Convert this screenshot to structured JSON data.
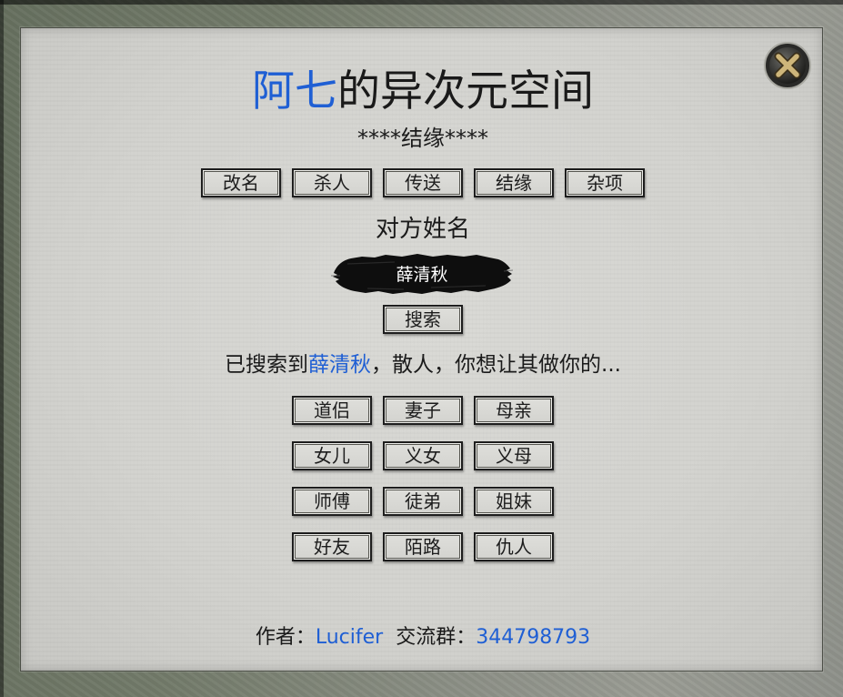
{
  "window": {
    "title_highlight": "阿七",
    "title_rest": "的异次元空间",
    "subtitle": "****结缘****"
  },
  "tabs": [
    {
      "label": "改名"
    },
    {
      "label": "杀人"
    },
    {
      "label": "传送"
    },
    {
      "label": "结缘"
    },
    {
      "label": "杂项"
    }
  ],
  "search": {
    "field_label": "对方姓名",
    "value": "薛清秋",
    "button_label": "搜索"
  },
  "result": {
    "prefix": "已搜索到",
    "name": "薛清秋",
    "suffix": "，散人，你想让其做你的..."
  },
  "relations": [
    {
      "label": "道侣"
    },
    {
      "label": "妻子"
    },
    {
      "label": "母亲"
    },
    {
      "label": "女儿"
    },
    {
      "label": "义女"
    },
    {
      "label": "义母"
    },
    {
      "label": "师傅"
    },
    {
      "label": "徒弟"
    },
    {
      "label": "姐妹"
    },
    {
      "label": "好友"
    },
    {
      "label": "陌路"
    },
    {
      "label": "仇人"
    }
  ],
  "footer": {
    "author_label": "作者：",
    "author": "Lucifer",
    "group_label": "交流群：",
    "group": "344798793"
  },
  "icons": {
    "close": "close-icon",
    "name_field_background": "ink-brush-stroke"
  },
  "colors": {
    "accent": "#1f5fd4",
    "text": "#1a1a1a",
    "panel": "#d4d4d0",
    "ink": "#0e0e0e",
    "name_text": "#ffffff"
  }
}
